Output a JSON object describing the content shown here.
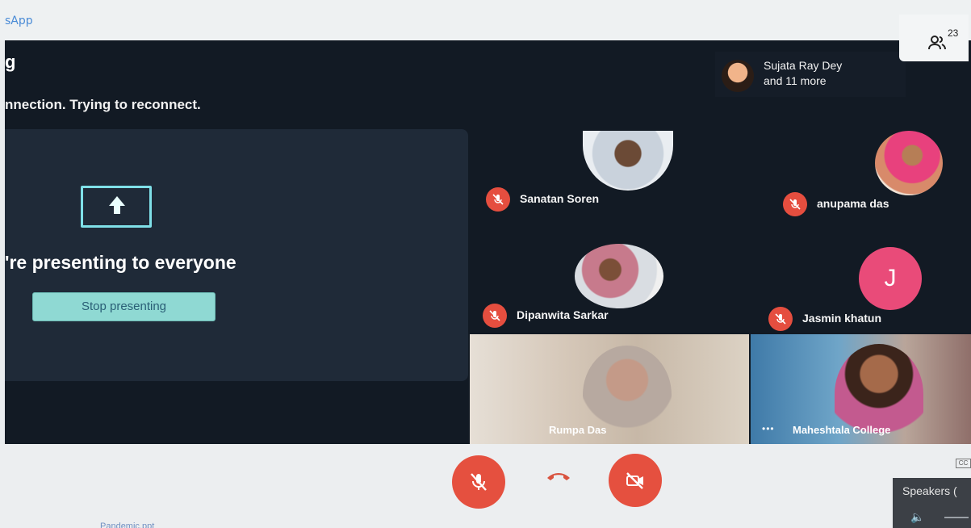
{
  "browser": {
    "app_name": "sApp"
  },
  "meeting": {
    "title": "g",
    "connection_banner": "nnection. Trying to reconnect."
  },
  "presenting": {
    "message": "'re presenting to everyone",
    "stop_button": "Stop presenting",
    "icon": "present-to-all-icon"
  },
  "people_chip": {
    "line1": "Sujata Ray Dey",
    "line2": "and 11 more"
  },
  "people_button": {
    "count": "23",
    "icon": "people-icon"
  },
  "participants": [
    {
      "name": "Sanatan Soren",
      "muted": true
    },
    {
      "name": "anupama das",
      "muted": true
    },
    {
      "name": "Dipanwita Sarkar",
      "muted": true
    },
    {
      "name": "Jasmin khatun",
      "initial": "J",
      "muted": true,
      "avatar_color": "#e94b79"
    }
  ],
  "video_feeds": [
    {
      "label": "Rumpa Das"
    },
    {
      "label": "Maheshtala College",
      "dots": "•••"
    }
  ],
  "controls": {
    "mic_icon": "mic-off-icon",
    "hangup_icon": "hangup-icon",
    "camera_icon": "camera-off-icon",
    "cc_label": "CC"
  },
  "audio_panel": {
    "label": "Speakers (",
    "icon": "speaker-icon"
  },
  "taskbar": {
    "item": "Pandemic.ppt"
  },
  "colors": {
    "meet_bg": "#121a24",
    "mute_red": "#e54e3f",
    "stop_button": "#8fd9d3",
    "present_icon": "#7fe0e8"
  }
}
